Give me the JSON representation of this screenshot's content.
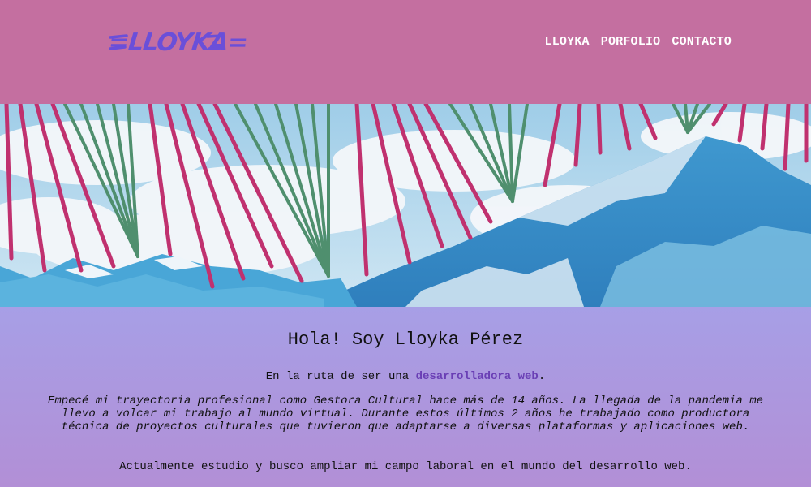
{
  "brand": {
    "logo_text": "=LLOYKA=",
    "logo_color": "#6a4fd9"
  },
  "nav": {
    "items": [
      "LLOYKA",
      "PORFOLIO",
      "CONTACTO"
    ]
  },
  "colors": {
    "header_bg": "#c46fa0",
    "content_bg_top": "#a79fe6",
    "content_bg_bottom": "#b28fd6",
    "link": "#6a3fb5"
  },
  "hero": {
    "image": "hand-stitched-mountain-photo"
  },
  "main": {
    "heading": "Hola! Soy Lloyka Pérez",
    "intro_prefix": "En la ruta de ser una",
    "intro_link": "desarrolladora web",
    "intro_suffix": ".",
    "bio": "Empecé mi trayectoria profesional como Gestora Cultural hace más de 14 años. La llegada de la pandemia me llevo a volcar mi trabajo al mundo virtual. Durante estos últimos 2 años he trabajado como productora técnica de proyectos culturales que tuvieron que adaptarse a diversas plataformas y aplicaciones web.",
    "now": "Actualmente estudio y busco ampliar mi campo laboral en el mundo del desarrollo web."
  }
}
